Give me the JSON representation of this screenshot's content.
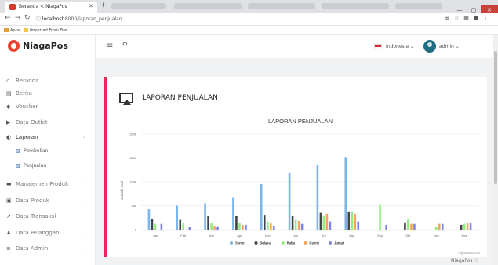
{
  "browser": {
    "tab_title": "Beranda < NiagaPos",
    "url_host": "localhost",
    "url_rest": ":8000/laporan_penjualan",
    "bookmarks": [
      "Apps",
      "Imported From Fire..."
    ]
  },
  "brand": {
    "name": "NiagaPos"
  },
  "sidebar": {
    "items": [
      {
        "label": "Beranda",
        "icon": "home-icon",
        "glyph": "⌂",
        "chev": ""
      },
      {
        "label": "Berita",
        "icon": "news-icon",
        "glyph": "▤",
        "chev": ""
      },
      {
        "label": "Voucher",
        "icon": "tag-icon",
        "glyph": "◆",
        "chev": ""
      },
      {
        "label": "Data Outlet",
        "icon": "flag-icon",
        "glyph": "▶",
        "chev": "›"
      },
      {
        "label": "Laporan",
        "icon": "pie-icon",
        "glyph": "◐",
        "chev": "⌄"
      },
      {
        "label": "Manajemen Produk",
        "icon": "truck-icon",
        "glyph": "▬",
        "chev": "›"
      },
      {
        "label": "Data Produk",
        "icon": "box-icon",
        "glyph": "▣",
        "chev": "›"
      },
      {
        "label": "Data Transaksi",
        "icon": "line-chart-icon",
        "glyph": "↗",
        "chev": "›"
      },
      {
        "label": "Data Pelanggan",
        "icon": "users-icon",
        "glyph": "♟",
        "chev": "›"
      },
      {
        "label": "Data Admin",
        "icon": "list-icon",
        "glyph": "≡",
        "chev": "›"
      }
    ],
    "sub_items": [
      {
        "label": "Pembelian",
        "icon": "bar-chart-icon",
        "glyph": "▥"
      },
      {
        "label": "Penjualan",
        "icon": "bar-chart-icon",
        "glyph": "▥"
      }
    ]
  },
  "topbar": {
    "language": "Indonesia ⌄",
    "user": "admin ⌄"
  },
  "page": {
    "title": "LAPORAN PENJUALAN"
  },
  "footer": {
    "brand": "NiagaPos ♡"
  },
  "colors": {
    "accent": "#e8285a",
    "senin": "#7cb5ec",
    "selasa": "#434348",
    "rabu": "#90ed7d",
    "kamis": "#f7a35c",
    "jumat": "#8085e9"
  },
  "chart_data": {
    "type": "bar",
    "title": "LAPORAN PENJUALAN",
    "ylabel": "Jumlah Jual",
    "credits": "Highcharts.com",
    "categories": [
      "Jan",
      "Feb",
      "Mar",
      "Apr",
      "Mei",
      "Jun",
      "Jul",
      "Aug",
      "Sep",
      "Okt",
      "Nov",
      "Des"
    ],
    "ylim": [
      0,
      200000
    ],
    "yticks": [
      0,
      50000,
      100000,
      150000,
      200000
    ],
    "ytick_labels": [
      "0",
      "50k",
      "100k",
      "150k",
      "200k"
    ],
    "legend_position": "bottom",
    "series": [
      {
        "name": "Senin",
        "color": "#7cb5ec",
        "values": [
          43000,
          50000,
          55000,
          68000,
          95000,
          118000,
          135000,
          152000,
          0,
          0,
          0,
          0
        ]
      },
      {
        "name": "Selasa",
        "color": "#434348",
        "values": [
          23000,
          22000,
          28000,
          28000,
          31000,
          28000,
          35000,
          38000,
          0,
          15000,
          0,
          10000
        ]
      },
      {
        "name": "Rabu",
        "color": "#90ed7d",
        "values": [
          12000,
          13000,
          14000,
          14000,
          17000,
          22000,
          30000,
          38000,
          53000,
          23000,
          5000,
          12000
        ]
      },
      {
        "name": "Kamis",
        "color": "#f7a35c",
        "values": [
          0,
          0,
          8000,
          10000,
          13000,
          18000,
          33000,
          33000,
          0,
          12000,
          12000,
          13000
        ]
      },
      {
        "name": "Jumat",
        "color": "#8085e9",
        "values": [
          12000,
          5000,
          7000,
          10000,
          8000,
          12000,
          17000,
          17000,
          10000,
          12000,
          12000,
          15000
        ]
      }
    ]
  }
}
